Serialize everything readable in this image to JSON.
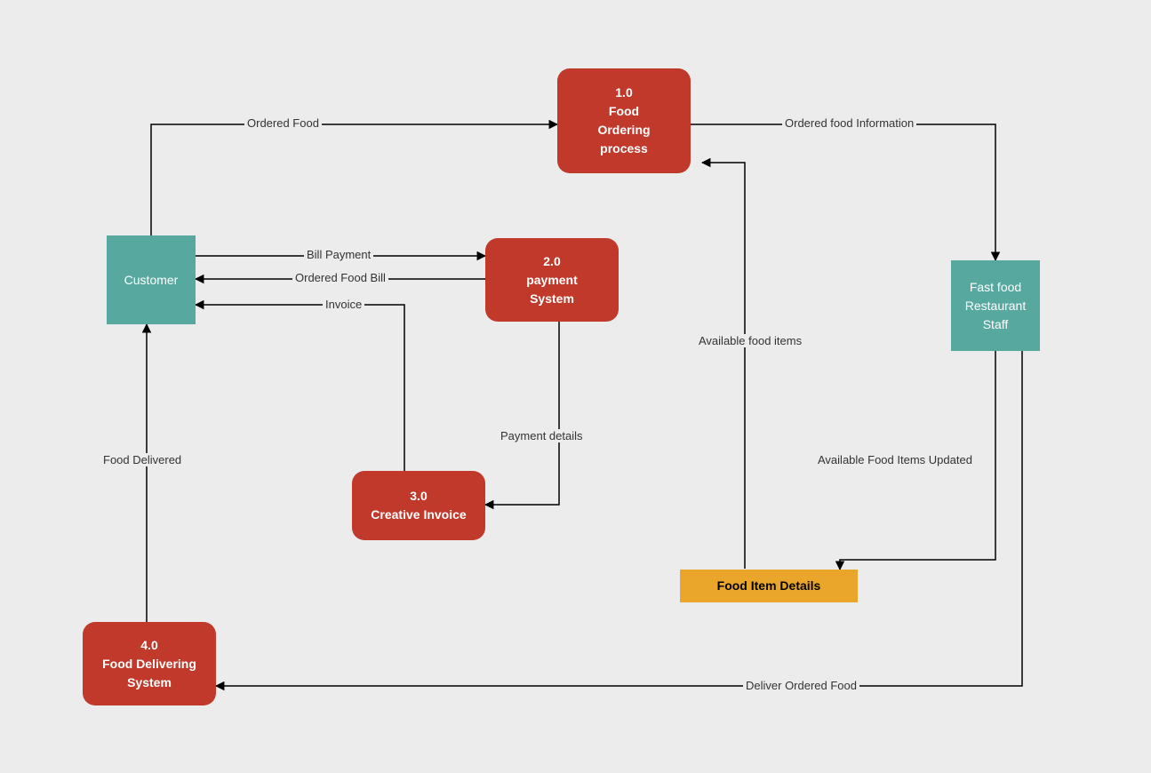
{
  "nodes": {
    "customer": {
      "label": "Customer"
    },
    "staff": {
      "line1": "Fast food",
      "line2": "Restaurant",
      "line3": "Staff"
    },
    "p1": {
      "num": "1.0",
      "line1": "Food",
      "line2": "Ordering",
      "line3": "process"
    },
    "p2": {
      "num": "2.0",
      "line1": "payment",
      "line2": "System"
    },
    "p3": {
      "num": "3.0",
      "line1": "Creative Invoice"
    },
    "p4": {
      "num": "4.0",
      "line1": "Food Delivering",
      "line2": "System"
    },
    "store": {
      "label": "Food Item Details"
    }
  },
  "edges": {
    "orderedFood": "Ordered Food",
    "orderedFoodInfo": "Ordered food Information",
    "billPayment": "Bill Payment",
    "orderedFoodBill": "Ordered Food Bill",
    "invoice": "Invoice",
    "paymentDetails": "Payment details",
    "availableFoodItems": "Available food items",
    "availableUpdated": "Available Food Items Updated",
    "deliverOrderedFood": "Deliver Ordered Food",
    "foodDelivered": "Food Delivered"
  }
}
